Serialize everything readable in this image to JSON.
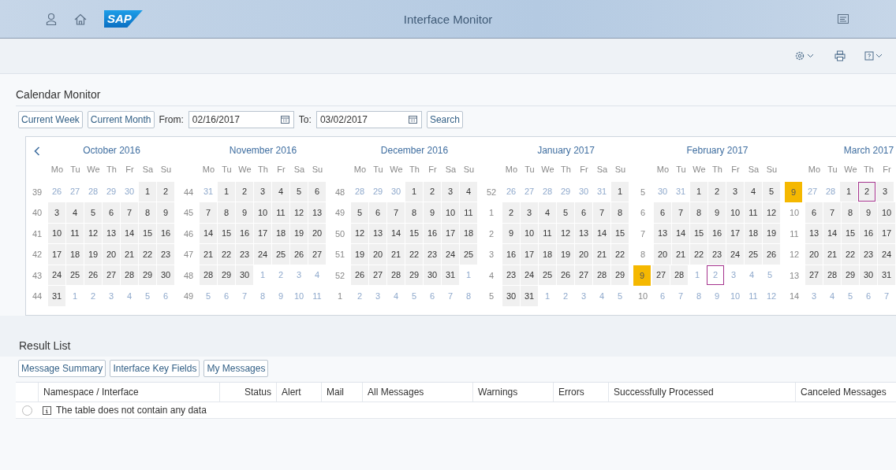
{
  "shell": {
    "logo": "SAP",
    "title": "Interface Monitor"
  },
  "calendar_monitor": {
    "title": "Calendar Monitor",
    "buttons": [
      "Current Week",
      "Current Month"
    ],
    "from_label": "From:",
    "from_value": "02/16/2017",
    "to_label": "To:",
    "to_value": "03/02/2017",
    "search_button": "Search",
    "months": [
      {
        "title": "October 2016",
        "weekdays": [
          "Mo",
          "Tu",
          "We",
          "Th",
          "Fr",
          "Sa",
          "Su"
        ],
        "weeks": [
          {
            "week": "39",
            "highlighted": false,
            "days": [
              {
                "day": "26",
                "faded": true,
                "outlined": false
              },
              {
                "day": "27",
                "faded": true,
                "outlined": false
              },
              {
                "day": "28",
                "faded": true,
                "outlined": false
              },
              {
                "day": "29",
                "faded": true,
                "outlined": false
              },
              {
                "day": "30",
                "faded": true,
                "outlined": false
              },
              {
                "day": "1",
                "faded": false,
                "outlined": false
              },
              {
                "day": "2",
                "faded": false,
                "outlined": false
              }
            ]
          },
          {
            "week": "40",
            "highlighted": false,
            "days": [
              {
                "day": "3",
                "faded": false,
                "outlined": false
              },
              {
                "day": "4",
                "faded": false,
                "outlined": false
              },
              {
                "day": "5",
                "faded": false,
                "outlined": false
              },
              {
                "day": "6",
                "faded": false,
                "outlined": false
              },
              {
                "day": "7",
                "faded": false,
                "outlined": false
              },
              {
                "day": "8",
                "faded": false,
                "outlined": false
              },
              {
                "day": "9",
                "faded": false,
                "outlined": false
              }
            ]
          },
          {
            "week": "41",
            "highlighted": false,
            "days": [
              {
                "day": "10",
                "faded": false,
                "outlined": false
              },
              {
                "day": "11",
                "faded": false,
                "outlined": false
              },
              {
                "day": "12",
                "faded": false,
                "outlined": false
              },
              {
                "day": "13",
                "faded": false,
                "outlined": false
              },
              {
                "day": "14",
                "faded": false,
                "outlined": false
              },
              {
                "day": "15",
                "faded": false,
                "outlined": false
              },
              {
                "day": "16",
                "faded": false,
                "outlined": false
              }
            ]
          },
          {
            "week": "42",
            "highlighted": false,
            "days": [
              {
                "day": "17",
                "faded": false,
                "outlined": false
              },
              {
                "day": "18",
                "faded": false,
                "outlined": false
              },
              {
                "day": "19",
                "faded": false,
                "outlined": false
              },
              {
                "day": "20",
                "faded": false,
                "outlined": false
              },
              {
                "day": "21",
                "faded": false,
                "outlined": false
              },
              {
                "day": "22",
                "faded": false,
                "outlined": false
              },
              {
                "day": "23",
                "faded": false,
                "outlined": false
              }
            ]
          },
          {
            "week": "43",
            "highlighted": false,
            "days": [
              {
                "day": "24",
                "faded": false,
                "outlined": false
              },
              {
                "day": "25",
                "faded": false,
                "outlined": false
              },
              {
                "day": "26",
                "faded": false,
                "outlined": false
              },
              {
                "day": "27",
                "faded": false,
                "outlined": false
              },
              {
                "day": "28",
                "faded": false,
                "outlined": false
              },
              {
                "day": "29",
                "faded": false,
                "outlined": false
              },
              {
                "day": "30",
                "faded": false,
                "outlined": false
              }
            ]
          },
          {
            "week": "44",
            "highlighted": false,
            "days": [
              {
                "day": "31",
                "faded": false,
                "outlined": false
              },
              {
                "day": "1",
                "faded": true,
                "outlined": false
              },
              {
                "day": "2",
                "faded": true,
                "outlined": false
              },
              {
                "day": "3",
                "faded": true,
                "outlined": false
              },
              {
                "day": "4",
                "faded": true,
                "outlined": false
              },
              {
                "day": "5",
                "faded": true,
                "outlined": false
              },
              {
                "day": "6",
                "faded": true,
                "outlined": false
              }
            ]
          }
        ]
      },
      {
        "title": "November 2016",
        "weekdays": [
          "Mo",
          "Tu",
          "We",
          "Th",
          "Fr",
          "Sa",
          "Su"
        ],
        "weeks": [
          {
            "week": "44",
            "highlighted": false,
            "days": [
              {
                "day": "31",
                "faded": true,
                "outlined": false
              },
              {
                "day": "1",
                "faded": false,
                "outlined": false
              },
              {
                "day": "2",
                "faded": false,
                "outlined": false
              },
              {
                "day": "3",
                "faded": false,
                "outlined": false
              },
              {
                "day": "4",
                "faded": false,
                "outlined": false
              },
              {
                "day": "5",
                "faded": false,
                "outlined": false
              },
              {
                "day": "6",
                "faded": false,
                "outlined": false
              }
            ]
          },
          {
            "week": "45",
            "highlighted": false,
            "days": [
              {
                "day": "7",
                "faded": false,
                "outlined": false
              },
              {
                "day": "8",
                "faded": false,
                "outlined": false
              },
              {
                "day": "9",
                "faded": false,
                "outlined": false
              },
              {
                "day": "10",
                "faded": false,
                "outlined": false
              },
              {
                "day": "11",
                "faded": false,
                "outlined": false
              },
              {
                "day": "12",
                "faded": false,
                "outlined": false
              },
              {
                "day": "13",
                "faded": false,
                "outlined": false
              }
            ]
          },
          {
            "week": "46",
            "highlighted": false,
            "days": [
              {
                "day": "14",
                "faded": false,
                "outlined": false
              },
              {
                "day": "15",
                "faded": false,
                "outlined": false
              },
              {
                "day": "16",
                "faded": false,
                "outlined": false
              },
              {
                "day": "17",
                "faded": false,
                "outlined": false
              },
              {
                "day": "18",
                "faded": false,
                "outlined": false
              },
              {
                "day": "19",
                "faded": false,
                "outlined": false
              },
              {
                "day": "20",
                "faded": false,
                "outlined": false
              }
            ]
          },
          {
            "week": "47",
            "highlighted": false,
            "days": [
              {
                "day": "21",
                "faded": false,
                "outlined": false
              },
              {
                "day": "22",
                "faded": false,
                "outlined": false
              },
              {
                "day": "23",
                "faded": false,
                "outlined": false
              },
              {
                "day": "24",
                "faded": false,
                "outlined": false
              },
              {
                "day": "25",
                "faded": false,
                "outlined": false
              },
              {
                "day": "26",
                "faded": false,
                "outlined": false
              },
              {
                "day": "27",
                "faded": false,
                "outlined": false
              }
            ]
          },
          {
            "week": "48",
            "highlighted": false,
            "days": [
              {
                "day": "28",
                "faded": false,
                "outlined": false
              },
              {
                "day": "29",
                "faded": false,
                "outlined": false
              },
              {
                "day": "30",
                "faded": false,
                "outlined": false
              },
              {
                "day": "1",
                "faded": true,
                "outlined": false
              },
              {
                "day": "2",
                "faded": true,
                "outlined": false
              },
              {
                "day": "3",
                "faded": true,
                "outlined": false
              },
              {
                "day": "4",
                "faded": true,
                "outlined": false
              }
            ]
          },
          {
            "week": "49",
            "highlighted": false,
            "days": [
              {
                "day": "5",
                "faded": true,
                "outlined": false
              },
              {
                "day": "6",
                "faded": true,
                "outlined": false
              },
              {
                "day": "7",
                "faded": true,
                "outlined": false
              },
              {
                "day": "8",
                "faded": true,
                "outlined": false
              },
              {
                "day": "9",
                "faded": true,
                "outlined": false
              },
              {
                "day": "10",
                "faded": true,
                "outlined": false
              },
              {
                "day": "11",
                "faded": true,
                "outlined": false
              }
            ]
          }
        ]
      },
      {
        "title": "December 2016",
        "weekdays": [
          "Mo",
          "Tu",
          "We",
          "Th",
          "Fr",
          "Sa",
          "Su"
        ],
        "weeks": [
          {
            "week": "48",
            "highlighted": false,
            "days": [
              {
                "day": "28",
                "faded": true,
                "outlined": false
              },
              {
                "day": "29",
                "faded": true,
                "outlined": false
              },
              {
                "day": "30",
                "faded": true,
                "outlined": false
              },
              {
                "day": "1",
                "faded": false,
                "outlined": false
              },
              {
                "day": "2",
                "faded": false,
                "outlined": false
              },
              {
                "day": "3",
                "faded": false,
                "outlined": false
              },
              {
                "day": "4",
                "faded": false,
                "outlined": false
              }
            ]
          },
          {
            "week": "49",
            "highlighted": false,
            "days": [
              {
                "day": "5",
                "faded": false,
                "outlined": false
              },
              {
                "day": "6",
                "faded": false,
                "outlined": false
              },
              {
                "day": "7",
                "faded": false,
                "outlined": false
              },
              {
                "day": "8",
                "faded": false,
                "outlined": false
              },
              {
                "day": "9",
                "faded": false,
                "outlined": false
              },
              {
                "day": "10",
                "faded": false,
                "outlined": false
              },
              {
                "day": "11",
                "faded": false,
                "outlined": false
              }
            ]
          },
          {
            "week": "50",
            "highlighted": false,
            "days": [
              {
                "day": "12",
                "faded": false,
                "outlined": false
              },
              {
                "day": "13",
                "faded": false,
                "outlined": false
              },
              {
                "day": "14",
                "faded": false,
                "outlined": false
              },
              {
                "day": "15",
                "faded": false,
                "outlined": false
              },
              {
                "day": "16",
                "faded": false,
                "outlined": false
              },
              {
                "day": "17",
                "faded": false,
                "outlined": false
              },
              {
                "day": "18",
                "faded": false,
                "outlined": false
              }
            ]
          },
          {
            "week": "51",
            "highlighted": false,
            "days": [
              {
                "day": "19",
                "faded": false,
                "outlined": false
              },
              {
                "day": "20",
                "faded": false,
                "outlined": false
              },
              {
                "day": "21",
                "faded": false,
                "outlined": false
              },
              {
                "day": "22",
                "faded": false,
                "outlined": false
              },
              {
                "day": "23",
                "faded": false,
                "outlined": false
              },
              {
                "day": "24",
                "faded": false,
                "outlined": false
              },
              {
                "day": "25",
                "faded": false,
                "outlined": false
              }
            ]
          },
          {
            "week": "52",
            "highlighted": false,
            "days": [
              {
                "day": "26",
                "faded": false,
                "outlined": false
              },
              {
                "day": "27",
                "faded": false,
                "outlined": false
              },
              {
                "day": "28",
                "faded": false,
                "outlined": false
              },
              {
                "day": "29",
                "faded": false,
                "outlined": false
              },
              {
                "day": "30",
                "faded": false,
                "outlined": false
              },
              {
                "day": "31",
                "faded": false,
                "outlined": false
              },
              {
                "day": "1",
                "faded": true,
                "outlined": false
              }
            ]
          },
          {
            "week": "1",
            "highlighted": false,
            "days": [
              {
                "day": "2",
                "faded": true,
                "outlined": false
              },
              {
                "day": "3",
                "faded": true,
                "outlined": false
              },
              {
                "day": "4",
                "faded": true,
                "outlined": false
              },
              {
                "day": "5",
                "faded": true,
                "outlined": false
              },
              {
                "day": "6",
                "faded": true,
                "outlined": false
              },
              {
                "day": "7",
                "faded": true,
                "outlined": false
              },
              {
                "day": "8",
                "faded": true,
                "outlined": false
              }
            ]
          }
        ]
      },
      {
        "title": "January 2017",
        "weekdays": [
          "Mo",
          "Tu",
          "We",
          "Th",
          "Fr",
          "Sa",
          "Su"
        ],
        "weeks": [
          {
            "week": "52",
            "highlighted": false,
            "days": [
              {
                "day": "26",
                "faded": true,
                "outlined": false
              },
              {
                "day": "27",
                "faded": true,
                "outlined": false
              },
              {
                "day": "28",
                "faded": true,
                "outlined": false
              },
              {
                "day": "29",
                "faded": true,
                "outlined": false
              },
              {
                "day": "30",
                "faded": true,
                "outlined": false
              },
              {
                "day": "31",
                "faded": true,
                "outlined": false
              },
              {
                "day": "1",
                "faded": false,
                "outlined": false
              }
            ]
          },
          {
            "week": "1",
            "highlighted": false,
            "days": [
              {
                "day": "2",
                "faded": false,
                "outlined": false
              },
              {
                "day": "3",
                "faded": false,
                "outlined": false
              },
              {
                "day": "4",
                "faded": false,
                "outlined": false
              },
              {
                "day": "5",
                "faded": false,
                "outlined": false
              },
              {
                "day": "6",
                "faded": false,
                "outlined": false
              },
              {
                "day": "7",
                "faded": false,
                "outlined": false
              },
              {
                "day": "8",
                "faded": false,
                "outlined": false
              }
            ]
          },
          {
            "week": "2",
            "highlighted": false,
            "days": [
              {
                "day": "9",
                "faded": false,
                "outlined": false
              },
              {
                "day": "10",
                "faded": false,
                "outlined": false
              },
              {
                "day": "11",
                "faded": false,
                "outlined": false
              },
              {
                "day": "12",
                "faded": false,
                "outlined": false
              },
              {
                "day": "13",
                "faded": false,
                "outlined": false
              },
              {
                "day": "14",
                "faded": false,
                "outlined": false
              },
              {
                "day": "15",
                "faded": false,
                "outlined": false
              }
            ]
          },
          {
            "week": "3",
            "highlighted": false,
            "days": [
              {
                "day": "16",
                "faded": false,
                "outlined": false
              },
              {
                "day": "17",
                "faded": false,
                "outlined": false
              },
              {
                "day": "18",
                "faded": false,
                "outlined": false
              },
              {
                "day": "19",
                "faded": false,
                "outlined": false
              },
              {
                "day": "20",
                "faded": false,
                "outlined": false
              },
              {
                "day": "21",
                "faded": false,
                "outlined": false
              },
              {
                "day": "22",
                "faded": false,
                "outlined": false
              }
            ]
          },
          {
            "week": "4",
            "highlighted": false,
            "days": [
              {
                "day": "23",
                "faded": false,
                "outlined": false
              },
              {
                "day": "24",
                "faded": false,
                "outlined": false
              },
              {
                "day": "25",
                "faded": false,
                "outlined": false
              },
              {
                "day": "26",
                "faded": false,
                "outlined": false
              },
              {
                "day": "27",
                "faded": false,
                "outlined": false
              },
              {
                "day": "28",
                "faded": false,
                "outlined": false
              },
              {
                "day": "29",
                "faded": false,
                "outlined": false
              }
            ]
          },
          {
            "week": "5",
            "highlighted": false,
            "days": [
              {
                "day": "30",
                "faded": false,
                "outlined": false
              },
              {
                "day": "31",
                "faded": false,
                "outlined": false
              },
              {
                "day": "1",
                "faded": true,
                "outlined": false
              },
              {
                "day": "2",
                "faded": true,
                "outlined": false
              },
              {
                "day": "3",
                "faded": true,
                "outlined": false
              },
              {
                "day": "4",
                "faded": true,
                "outlined": false
              },
              {
                "day": "5",
                "faded": true,
                "outlined": false
              }
            ]
          }
        ]
      },
      {
        "title": "February 2017",
        "weekdays": [
          "Mo",
          "Tu",
          "We",
          "Th",
          "Fr",
          "Sa",
          "Su"
        ],
        "weeks": [
          {
            "week": "5",
            "highlighted": false,
            "days": [
              {
                "day": "30",
                "faded": true,
                "outlined": false
              },
              {
                "day": "31",
                "faded": true,
                "outlined": false
              },
              {
                "day": "1",
                "faded": false,
                "outlined": false
              },
              {
                "day": "2",
                "faded": false,
                "outlined": false
              },
              {
                "day": "3",
                "faded": false,
                "outlined": false
              },
              {
                "day": "4",
                "faded": false,
                "outlined": false
              },
              {
                "day": "5",
                "faded": false,
                "outlined": false
              }
            ]
          },
          {
            "week": "6",
            "highlighted": false,
            "days": [
              {
                "day": "6",
                "faded": false,
                "outlined": false
              },
              {
                "day": "7",
                "faded": false,
                "outlined": false
              },
              {
                "day": "8",
                "faded": false,
                "outlined": false
              },
              {
                "day": "9",
                "faded": false,
                "outlined": false
              },
              {
                "day": "10",
                "faded": false,
                "outlined": false
              },
              {
                "day": "11",
                "faded": false,
                "outlined": false
              },
              {
                "day": "12",
                "faded": false,
                "outlined": false
              }
            ]
          },
          {
            "week": "7",
            "highlighted": false,
            "days": [
              {
                "day": "13",
                "faded": false,
                "outlined": false
              },
              {
                "day": "14",
                "faded": false,
                "outlined": false
              },
              {
                "day": "15",
                "faded": false,
                "outlined": false
              },
              {
                "day": "16",
                "faded": false,
                "outlined": false
              },
              {
                "day": "17",
                "faded": false,
                "outlined": false
              },
              {
                "day": "18",
                "faded": false,
                "outlined": false
              },
              {
                "day": "19",
                "faded": false,
                "outlined": false
              }
            ]
          },
          {
            "week": "8",
            "highlighted": false,
            "days": [
              {
                "day": "20",
                "faded": false,
                "outlined": false
              },
              {
                "day": "21",
                "faded": false,
                "outlined": false
              },
              {
                "day": "22",
                "faded": false,
                "outlined": false
              },
              {
                "day": "23",
                "faded": false,
                "outlined": false
              },
              {
                "day": "24",
                "faded": false,
                "outlined": false
              },
              {
                "day": "25",
                "faded": false,
                "outlined": false
              },
              {
                "day": "26",
                "faded": false,
                "outlined": false
              }
            ]
          },
          {
            "week": "9",
            "highlighted": true,
            "days": [
              {
                "day": "27",
                "faded": false,
                "outlined": false
              },
              {
                "day": "28",
                "faded": false,
                "outlined": false
              },
              {
                "day": "1",
                "faded": true,
                "outlined": false
              },
              {
                "day": "2",
                "faded": true,
                "outlined": true
              },
              {
                "day": "3",
                "faded": true,
                "outlined": false
              },
              {
                "day": "4",
                "faded": true,
                "outlined": false
              },
              {
                "day": "5",
                "faded": true,
                "outlined": false
              }
            ]
          },
          {
            "week": "10",
            "highlighted": false,
            "days": [
              {
                "day": "6",
                "faded": true,
                "outlined": false
              },
              {
                "day": "7",
                "faded": true,
                "outlined": false
              },
              {
                "day": "8",
                "faded": true,
                "outlined": false
              },
              {
                "day": "9",
                "faded": true,
                "outlined": false
              },
              {
                "day": "10",
                "faded": true,
                "outlined": false
              },
              {
                "day": "11",
                "faded": true,
                "outlined": false
              },
              {
                "day": "12",
                "faded": true,
                "outlined": false
              }
            ]
          }
        ]
      },
      {
        "title": "March 2017",
        "weekdays": [
          "Mo",
          "Tu",
          "We",
          "Th",
          "Fr"
        ],
        "weeks": [
          {
            "week": "9",
            "highlighted": true,
            "days": [
              {
                "day": "27",
                "faded": true,
                "outlined": false
              },
              {
                "day": "28",
                "faded": true,
                "outlined": false
              },
              {
                "day": "1",
                "faded": false,
                "outlined": false
              },
              {
                "day": "2",
                "faded": false,
                "outlined": true
              },
              {
                "day": "3",
                "faded": false,
                "outlined": false
              }
            ]
          },
          {
            "week": "10",
            "highlighted": false,
            "days": [
              {
                "day": "6",
                "faded": false,
                "outlined": false
              },
              {
                "day": "7",
                "faded": false,
                "outlined": false
              },
              {
                "day": "8",
                "faded": false,
                "outlined": false
              },
              {
                "day": "9",
                "faded": false,
                "outlined": false
              },
              {
                "day": "10",
                "faded": false,
                "outlined": false
              }
            ]
          },
          {
            "week": "11",
            "highlighted": false,
            "days": [
              {
                "day": "13",
                "faded": false,
                "outlined": false
              },
              {
                "day": "14",
                "faded": false,
                "outlined": false
              },
              {
                "day": "15",
                "faded": false,
                "outlined": false
              },
              {
                "day": "16",
                "faded": false,
                "outlined": false
              },
              {
                "day": "17",
                "faded": false,
                "outlined": false
              }
            ]
          },
          {
            "week": "12",
            "highlighted": false,
            "days": [
              {
                "day": "20",
                "faded": false,
                "outlined": false
              },
              {
                "day": "21",
                "faded": false,
                "outlined": false
              },
              {
                "day": "22",
                "faded": false,
                "outlined": false
              },
              {
                "day": "23",
                "faded": false,
                "outlined": false
              },
              {
                "day": "24",
                "faded": false,
                "outlined": false
              }
            ]
          },
          {
            "week": "13",
            "highlighted": false,
            "days": [
              {
                "day": "27",
                "faded": false,
                "outlined": false
              },
              {
                "day": "28",
                "faded": false,
                "outlined": false
              },
              {
                "day": "29",
                "faded": false,
                "outlined": false
              },
              {
                "day": "30",
                "faded": false,
                "outlined": false
              },
              {
                "day": "31",
                "faded": false,
                "outlined": false
              }
            ]
          },
          {
            "week": "14",
            "highlighted": false,
            "days": [
              {
                "day": "3",
                "faded": true,
                "outlined": false
              },
              {
                "day": "4",
                "faded": true,
                "outlined": false
              },
              {
                "day": "5",
                "faded": true,
                "outlined": false
              },
              {
                "day": "6",
                "faded": true,
                "outlined": false
              },
              {
                "day": "7",
                "faded": true,
                "outlined": false
              }
            ]
          }
        ]
      }
    ]
  },
  "result_list": {
    "title": "Result List",
    "buttons": [
      "Message Summary",
      "Interface Key Fields",
      "My Messages"
    ],
    "columns": [
      "Namespace / Interface",
      "Status",
      "Alert",
      "Mail",
      "All Messages",
      "Warnings",
      "Errors",
      "Successfully Processed",
      "Canceled Messages"
    ],
    "empty_row": {
      "selected": false,
      "message": "The table does not contain any data"
    }
  }
}
